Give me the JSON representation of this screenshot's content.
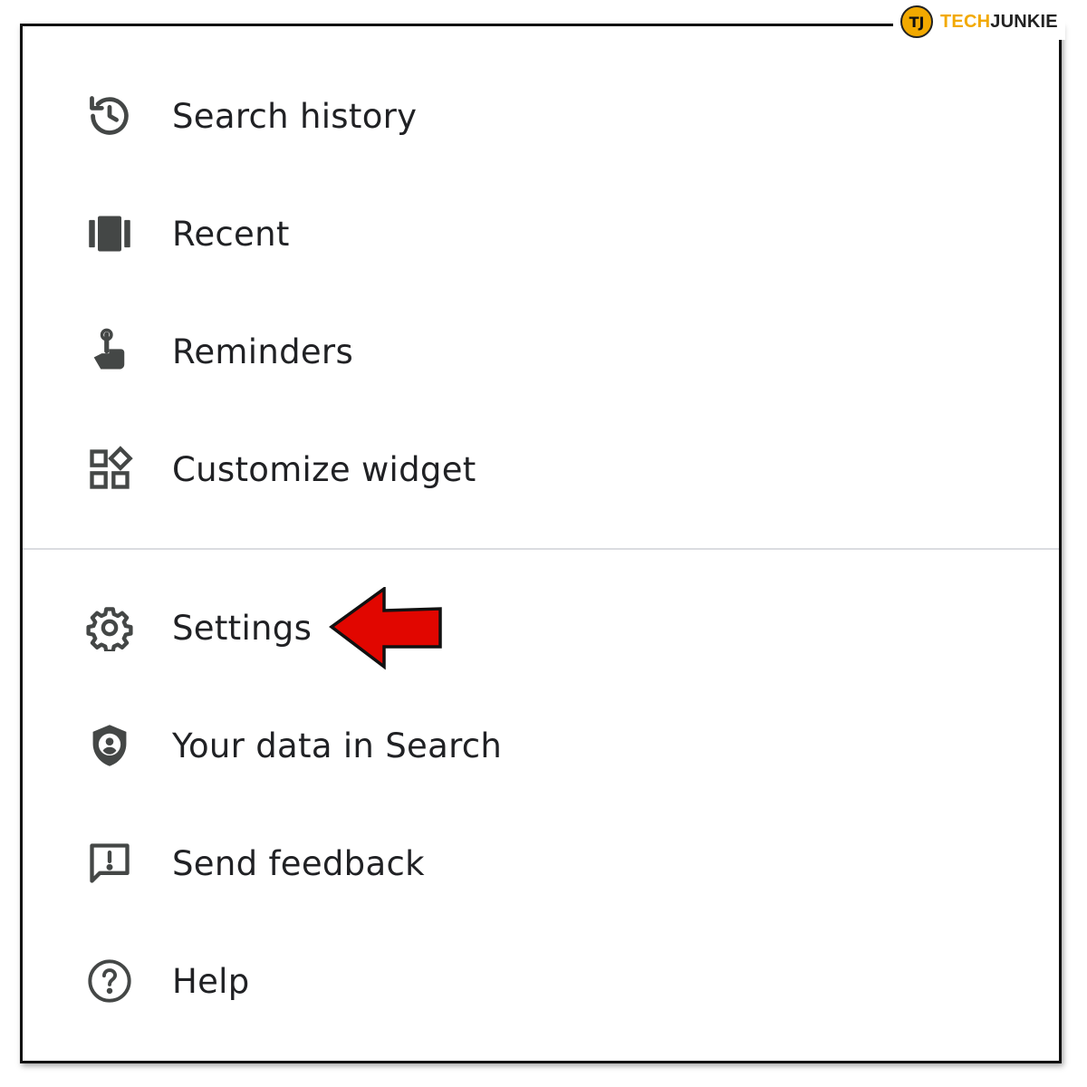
{
  "menu": {
    "items": [
      {
        "label": "Search history",
        "icon": "history-icon"
      },
      {
        "label": "Recent",
        "icon": "recent-icon"
      },
      {
        "label": "Reminders",
        "icon": "reminder-icon"
      },
      {
        "label": "Customize widget",
        "icon": "widgets-icon"
      },
      {
        "label": "Settings",
        "icon": "gear-icon"
      },
      {
        "label": "Your data in Search",
        "icon": "shield-account-icon"
      },
      {
        "label": "Send feedback",
        "icon": "feedback-icon"
      },
      {
        "label": "Help",
        "icon": "help-icon"
      }
    ]
  },
  "watermark": {
    "brand_tech": "TECH",
    "brand_junkie": "JUNKIE",
    "badge": "TJ"
  },
  "colors": {
    "text": "#202124",
    "icon": "#444746",
    "divider": "#dadce0",
    "annotation_arrow": "#e10600",
    "brand": "#f2a900"
  }
}
